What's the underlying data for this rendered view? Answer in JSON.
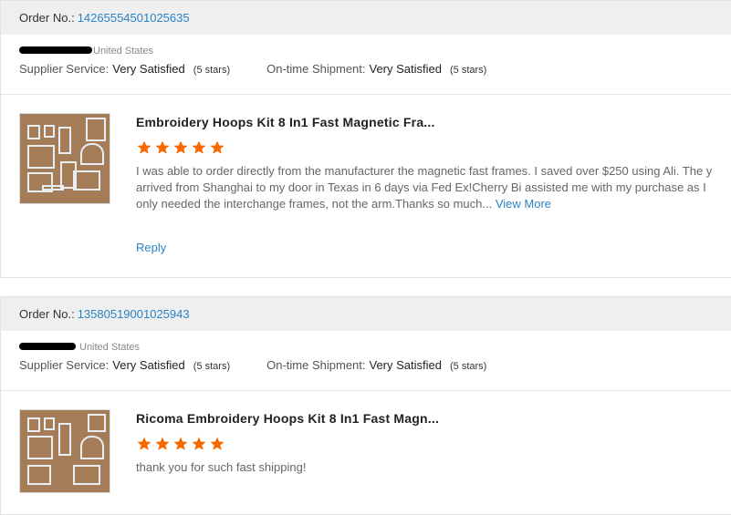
{
  "orders": [
    {
      "order_label": "Order No.:",
      "order_number": "14265554501025635",
      "buyer_country": "United States",
      "supplier_service_label": "Supplier Service:",
      "supplier_service_value": "Very Satisfied",
      "supplier_service_stars": "(5 stars)",
      "shipment_label": "On-time Shipment:",
      "shipment_value": "Very Satisfied",
      "shipment_stars": "(5 stars)",
      "product_title": "Embroidery Hoops Kit 8 In1 Fast Magnetic Fra...",
      "rating": 5,
      "review_text": "I was able to order directly from the manufacturer the magnetic fast frames. I saved over $250 using Ali. The y arrived from Shanghai to my door in Texas in 6 days via Fed Ex!Cherry Bi assisted me with my purchase as  I only needed the interchange frames, not the arm.Thanks so much...",
      "view_more": "View More",
      "reply": "Reply"
    },
    {
      "order_label": "Order No.:",
      "order_number": "13580519001025943",
      "buyer_country": "United States",
      "supplier_service_label": "Supplier Service:",
      "supplier_service_value": "Very Satisfied",
      "supplier_service_stars": "(5 stars)",
      "shipment_label": "On-time Shipment:",
      "shipment_value": "Very Satisfied",
      "shipment_stars": "(5 stars)",
      "product_title": "Ricoma Embroidery Hoops Kit 8 In1 Fast Magn...",
      "rating": 5,
      "review_text": "thank you for such fast shipping!"
    }
  ],
  "colors": {
    "link": "#2a83c5",
    "star": "#f56a00",
    "header_bg": "#efefef"
  },
  "icons": {
    "star": "star-icon",
    "thumbnail": "product-thumbnail"
  }
}
